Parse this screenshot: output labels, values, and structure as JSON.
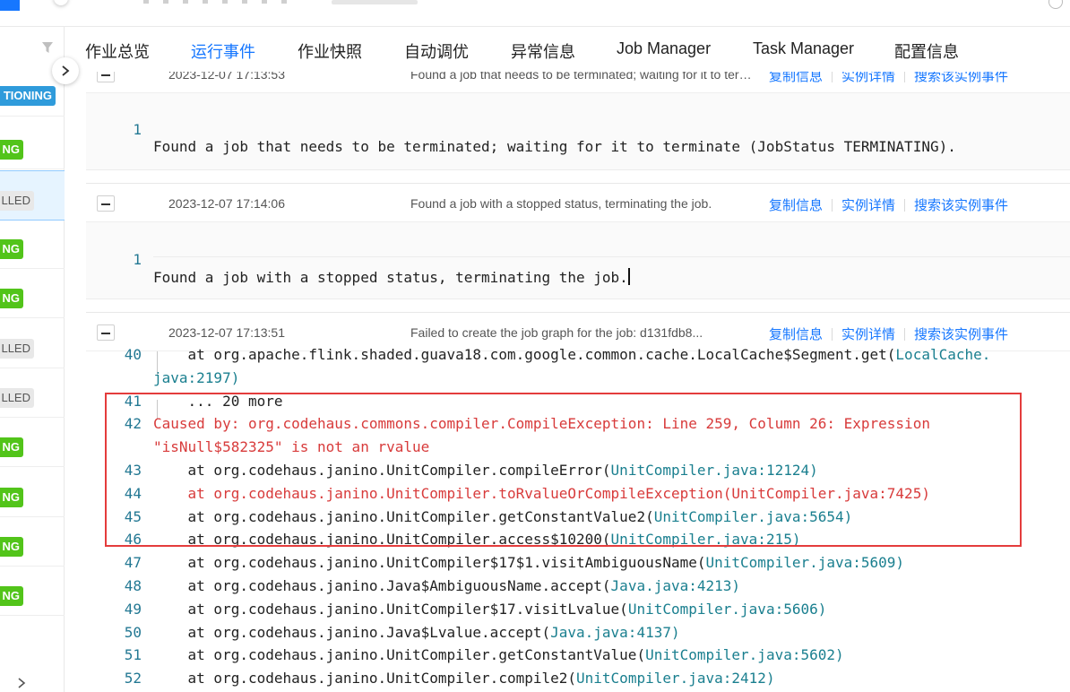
{
  "tabs": [
    {
      "label": "作业总览",
      "active": false
    },
    {
      "label": "运行事件",
      "active": true
    },
    {
      "label": "作业快照",
      "active": false
    },
    {
      "label": "自动调优",
      "active": false
    },
    {
      "label": "异常信息",
      "active": false
    },
    {
      "label": "Job Manager",
      "active": false
    },
    {
      "label": "Task Manager",
      "active": false
    },
    {
      "label": "配置信息",
      "active": false
    }
  ],
  "left_tags": [
    {
      "text": "TIONING",
      "color": "blue"
    },
    {
      "text": "NG",
      "color": "green"
    },
    {
      "text": "LLED",
      "color": "gray"
    },
    {
      "text": "NG",
      "color": "green"
    },
    {
      "text": "NG",
      "color": "green"
    },
    {
      "text": "LLED",
      "color": "gray"
    },
    {
      "text": "LLED",
      "color": "gray"
    },
    {
      "text": "NG",
      "color": "green"
    },
    {
      "text": "NG",
      "color": "green"
    },
    {
      "text": "NG",
      "color": "green"
    },
    {
      "text": "NG",
      "color": "green"
    }
  ],
  "actions": {
    "copy": "复制信息",
    "detail": "实例详情",
    "search": "搜索该实例事件"
  },
  "events": [
    {
      "time": "2023-12-07 17:13:53",
      "summary": "Found a job that needs to be terminated; waiting for it to terminate (JobStatus TERMINATING).",
      "lines": [
        {
          "n": "1",
          "text": "Found a job that needs to be terminated; waiting for it to terminate (JobStatus TERMINATING)."
        }
      ]
    },
    {
      "time": "2023-12-07 17:14:06",
      "summary": "Found a job with a stopped status, terminating the job.",
      "lines": [
        {
          "n": "1",
          "text": "Found a job with a stopped status, terminating the job."
        }
      ]
    },
    {
      "time": "2023-12-07 17:13:51",
      "summary": "Failed to create the job graph for the job: d131fdb8...",
      "lines": [
        {
          "n": "40",
          "text": "    at org.apache.flink.shaded.guava18.com.google.common.cache.LocalCache$Segment.get(",
          "file": "LocalCache."
        },
        {
          "n": "",
          "text": "",
          "file": "java:2197)"
        },
        {
          "n": "41",
          "text": "    ... 20 more"
        },
        {
          "n": "42",
          "text": "Caused by: org.codehaus.commons.compiler.CompileException: Line 259, Column 26: Expression",
          "red": true
        },
        {
          "n": "",
          "text": "\"isNull$582325\" is not an rvalue",
          "red": true
        },
        {
          "n": "43",
          "text": "    at org.codehaus.janino.UnitCompiler.compileError(",
          "file": "UnitCompiler.java:12124)"
        },
        {
          "n": "44",
          "text": "    at org.codehaus.janino.UnitCompiler.toRvalueOrCompileException(UnitCompiler.java:7425)",
          "red": true
        },
        {
          "n": "45",
          "text": "    at org.codehaus.janino.UnitCompiler.getConstantValue2(",
          "file": "UnitCompiler.java:5654)"
        },
        {
          "n": "46",
          "text": "    at org.codehaus.janino.UnitCompiler.access$10200(",
          "file": "UnitCompiler.java:215)"
        },
        {
          "n": "47",
          "text": "    at org.codehaus.janino.UnitCompiler$17$1.visitAmbiguousName(",
          "file": "UnitCompiler.java:5609)"
        },
        {
          "n": "48",
          "text": "    at org.codehaus.janino.Java$AmbiguousName.accept(",
          "file": "Java.java:4213)"
        },
        {
          "n": "49",
          "text": "    at org.codehaus.janino.UnitCompiler$17.visitLvalue(",
          "file": "UnitCompiler.java:5606)"
        },
        {
          "n": "50",
          "text": "    at org.codehaus.janino.Java$Lvalue.accept(",
          "file": "Java.java:4137)"
        },
        {
          "n": "51",
          "text": "    at org.codehaus.janino.UnitCompiler.getConstantValue(",
          "file": "UnitCompiler.java:5602)"
        },
        {
          "n": "52",
          "text": "    at org.codehaus.janino.UnitCompiler.compile2(",
          "file": "UnitCompiler.java:2412)"
        }
      ]
    }
  ],
  "colors": {
    "accent": "#1677ff",
    "error": "#d83b3b",
    "file_ref": "#1a7f8f",
    "line_number": "#237893",
    "highlight_box": "#e43c3c"
  }
}
